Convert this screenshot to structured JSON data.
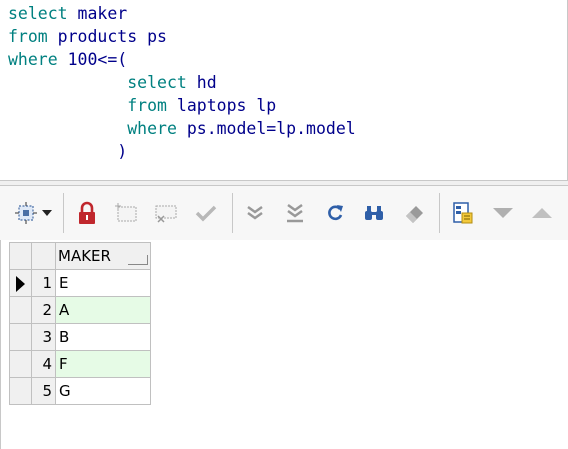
{
  "editor": {
    "lines": [
      [
        {
          "t": "select",
          "k": "kw"
        },
        {
          "t": " maker",
          "k": "id"
        }
      ],
      [
        {
          "t": "from",
          "k": "kw"
        },
        {
          "t": " products ps",
          "k": "id"
        }
      ],
      [
        {
          "t": "where",
          "k": "kw"
        },
        {
          "t": " 100<=(",
          "k": "id"
        }
      ],
      [
        {
          "t": "            ",
          "k": "id"
        },
        {
          "t": "select",
          "k": "kw"
        },
        {
          "t": " hd",
          "k": "id"
        }
      ],
      [
        {
          "t": "            ",
          "k": "id"
        },
        {
          "t": "from",
          "k": "kw"
        },
        {
          "t": " laptops lp",
          "k": "id"
        }
      ],
      [
        {
          "t": "            ",
          "k": "id"
        },
        {
          "t": "where",
          "k": "kw"
        },
        {
          "t": " ps.model=lp.model",
          "k": "id"
        }
      ],
      [
        {
          "t": "           )",
          "k": "id"
        }
      ]
    ]
  },
  "toolbar": {
    "buttons": [
      {
        "name": "select-cells-dropdown-icon"
      },
      {
        "name": "lock-icon"
      },
      {
        "name": "new-record-icon"
      },
      {
        "name": "delete-record-icon"
      },
      {
        "name": "post-edit-checkmark-icon"
      },
      {
        "name": "fetch-next-page-icon"
      },
      {
        "name": "fetch-all-icon"
      },
      {
        "name": "refresh-icon"
      },
      {
        "name": "find-binoculars-icon"
      },
      {
        "name": "clear-eraser-icon"
      },
      {
        "name": "record-view-icon"
      },
      {
        "name": "move-down-icon"
      },
      {
        "name": "move-up-icon"
      }
    ]
  },
  "grid": {
    "columns": [
      "MAKER"
    ],
    "rows": [
      {
        "num": "1",
        "maker": "E",
        "current": true
      },
      {
        "num": "2",
        "maker": "A",
        "current": false
      },
      {
        "num": "3",
        "maker": "B",
        "current": false
      },
      {
        "num": "4",
        "maker": "F",
        "current": false
      },
      {
        "num": "5",
        "maker": "G",
        "current": false
      }
    ]
  },
  "colors": {
    "keyword": "#008080",
    "identifier": "#00008b",
    "alt_row": "#e6fbe6",
    "lock_red": "#c0272d"
  }
}
